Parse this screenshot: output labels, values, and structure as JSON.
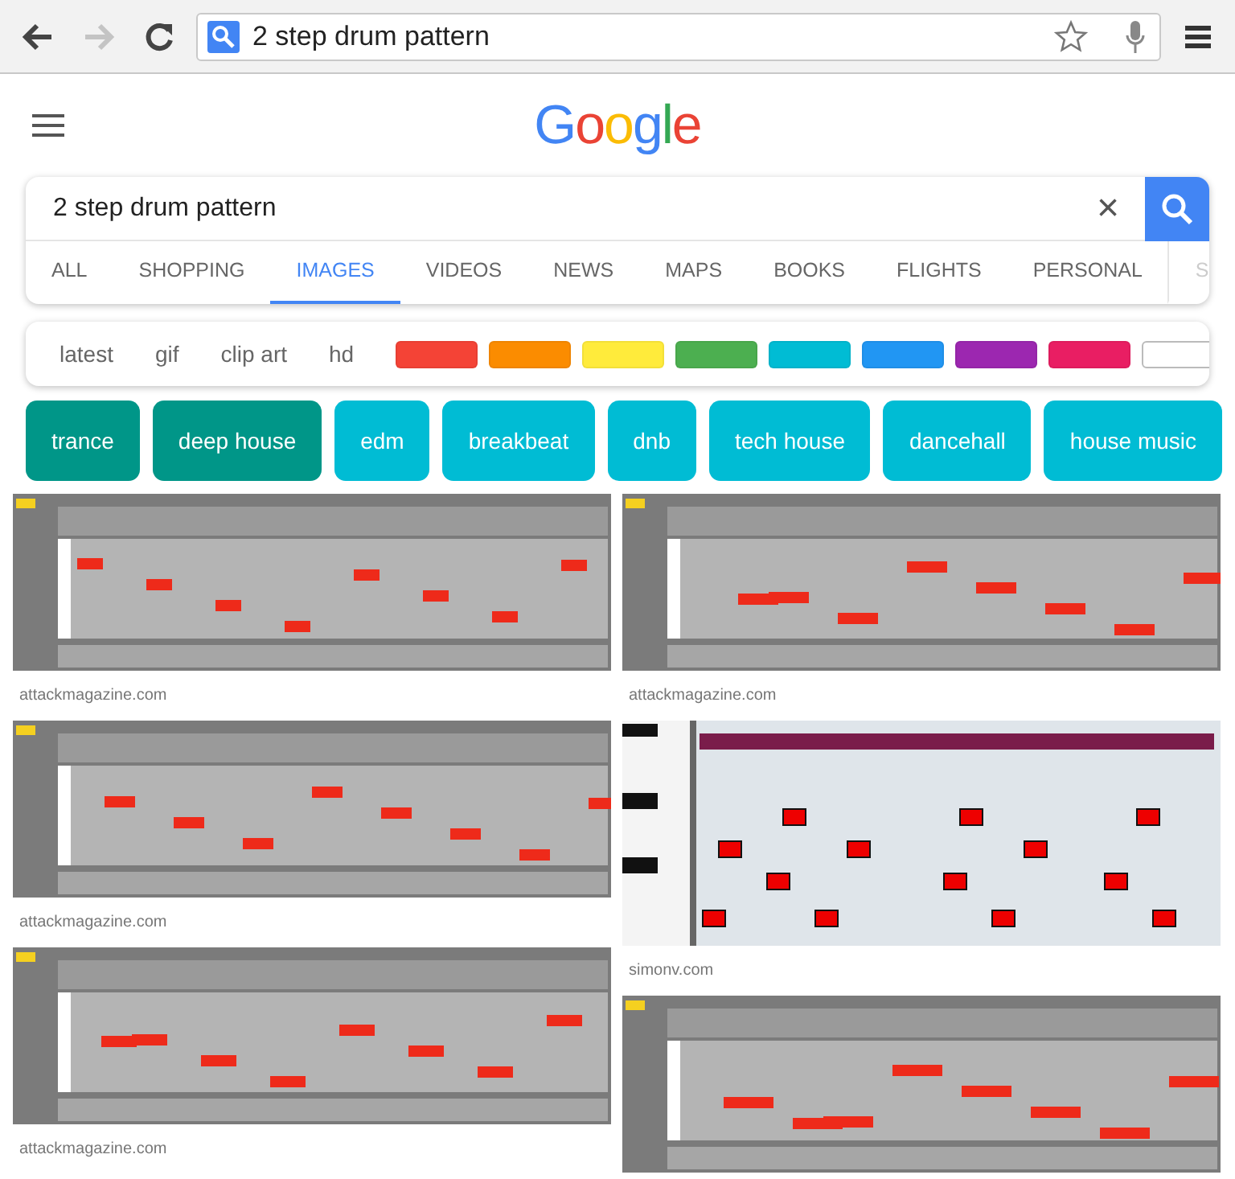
{
  "browser": {
    "back": {
      "disabled": false
    },
    "forward": {
      "disabled": true
    },
    "address": "2 step drum pattern"
  },
  "logo": "Google",
  "search": {
    "query": "2 step drum pattern",
    "clear": "×"
  },
  "tabs": [
    {
      "label": "ALL",
      "selected": false
    },
    {
      "label": "SHOPPING",
      "selected": false
    },
    {
      "label": "IMAGES",
      "selected": true
    },
    {
      "label": "VIDEOS",
      "selected": false
    },
    {
      "label": "NEWS",
      "selected": false
    },
    {
      "label": "MAPS",
      "selected": false
    },
    {
      "label": "BOOKS",
      "selected": false
    },
    {
      "label": "FLIGHTS",
      "selected": false
    },
    {
      "label": "PERSONAL",
      "selected": false
    },
    {
      "label": "S",
      "selected": false
    }
  ],
  "filters": [
    {
      "label": "latest"
    },
    {
      "label": "gif"
    },
    {
      "label": "clip art"
    },
    {
      "label": "hd"
    }
  ],
  "swatches": [
    {
      "color": "#f44336"
    },
    {
      "color": "#fb8c00"
    },
    {
      "color": "#ffeb3b"
    },
    {
      "color": "#4caf50"
    },
    {
      "color": "#00bcd4"
    },
    {
      "color": "#2196f3"
    },
    {
      "color": "#9c27b0"
    },
    {
      "color": "#e91e63"
    },
    {
      "color": "#ffffff"
    }
  ],
  "chips": [
    {
      "label": "trance",
      "color": "#009688"
    },
    {
      "label": "deep house",
      "color": "#009688"
    },
    {
      "label": "edm",
      "color": "#00bcd4"
    },
    {
      "label": "breakbeat",
      "color": "#00bcd4"
    },
    {
      "label": "dnb",
      "color": "#00bcd4"
    },
    {
      "label": "tech house",
      "color": "#00bcd4"
    },
    {
      "label": "dancehall",
      "color": "#00bcd4"
    },
    {
      "label": "house music",
      "color": "#00bcd4"
    }
  ],
  "results": [
    [
      {
        "kind": "picture",
        "source": "attackmagazine.com"
      },
      {
        "kind": "picture",
        "source": "attackmagazine.com"
      },
      {
        "kind": "picture",
        "source": "attackmagazine.com"
      }
    ],
    [
      {
        "kind": "picture",
        "source": "attackmagazine.com"
      },
      {
        "kind": "picture",
        "source": "simonv.com"
      },
      {
        "kind": "picture"
      }
    ]
  ]
}
